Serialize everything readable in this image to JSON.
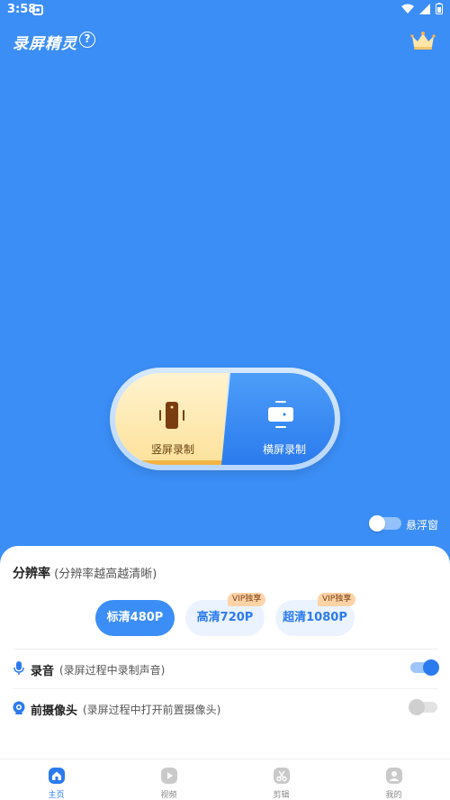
{
  "status_bar": {
    "time": "3:58"
  },
  "header": {
    "title": "录屏精灵",
    "help_symbol": "?"
  },
  "record": {
    "portrait_label": "竖屏录制",
    "landscape_label": "横屏录制"
  },
  "floating_window": {
    "label": "悬浮窗",
    "enabled": false
  },
  "resolution": {
    "title": "分辨率",
    "subtitle": "(分辨率越高越清晰)",
    "options": [
      {
        "label": "标清480P",
        "selected": true
      },
      {
        "label": "高清720P",
        "badge": "VIP独享"
      },
      {
        "label": "超清1080P",
        "badge": "VIP独享"
      }
    ]
  },
  "audio": {
    "title": "录音",
    "description": "(录屏过程中录制声音)",
    "enabled": true
  },
  "front_camera": {
    "title": "前摄像头",
    "description": "(录屏过程中打开前置摄像头)",
    "enabled": false
  },
  "nav": {
    "items": [
      {
        "label": "主页",
        "icon": "home-icon",
        "active": true
      },
      {
        "label": "视频",
        "icon": "play-icon"
      },
      {
        "label": "剪辑",
        "icon": "scissors-icon"
      },
      {
        "label": "我的",
        "icon": "user-icon"
      }
    ]
  },
  "colors": {
    "primary": "#3b8ef6",
    "accent": "#2b7bee",
    "vip_badge": "#ffd3a8"
  }
}
